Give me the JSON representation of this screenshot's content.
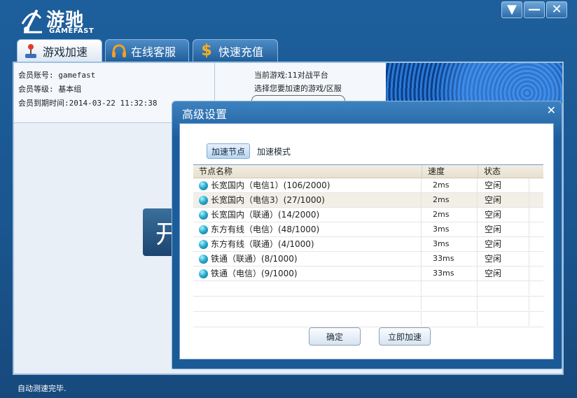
{
  "app": {
    "logo_text": "游驰",
    "logo_sub": "GAMEFAST"
  },
  "window_buttons": [
    "▼",
    "—",
    "✕"
  ],
  "tabs": [
    {
      "label": "游戏加速",
      "icon": "joystick-icon",
      "active": true
    },
    {
      "label": "在线客服",
      "icon": "headset-icon",
      "active": false
    },
    {
      "label": "快速充值",
      "icon": "dollar-icon",
      "active": false
    }
  ],
  "member": {
    "account": "会员账号: gamefast",
    "level": "会员等级: 基本组",
    "expire": "会员到期时间:2014-03-22 11:32:38"
  },
  "game": {
    "current": "当前游戏:11对战平台",
    "choose": "选择您要加速的游戏/区服"
  },
  "start_button_glyph": "开",
  "status_text": "自动测速完毕.",
  "dialog": {
    "title": "高级设置",
    "close": "✕",
    "sub_tabs": [
      {
        "label": "加速节点",
        "active": true
      },
      {
        "label": "加速模式",
        "active": false
      }
    ],
    "table": {
      "headers": {
        "name": "节点名称",
        "speed": "速度",
        "status": "状态"
      },
      "rows": [
        {
          "name": "长宽国内（电信1）(106/2000)",
          "speed": "2ms",
          "status": "空闲",
          "selected": false
        },
        {
          "name": "长宽国内（电信3）(27/1000)",
          "speed": "2ms",
          "status": "空闲",
          "selected": true
        },
        {
          "name": "长宽国内（联通）(14/2000)",
          "speed": "2ms",
          "status": "空闲",
          "selected": false
        },
        {
          "name": "东方有线（电信）(48/1000)",
          "speed": "3ms",
          "status": "空闲",
          "selected": false
        },
        {
          "name": "东方有线（联通）(4/1000)",
          "speed": "3ms",
          "status": "空闲",
          "selected": false
        },
        {
          "name": "铁通（联通）(8/1000)",
          "speed": "33ms",
          "status": "空闲",
          "selected": false
        },
        {
          "name": "铁通（电信）(9/1000)",
          "speed": "33ms",
          "status": "空闲",
          "selected": false
        }
      ]
    },
    "buttons": {
      "ok": "确定",
      "accelerate": "立即加速"
    }
  }
}
